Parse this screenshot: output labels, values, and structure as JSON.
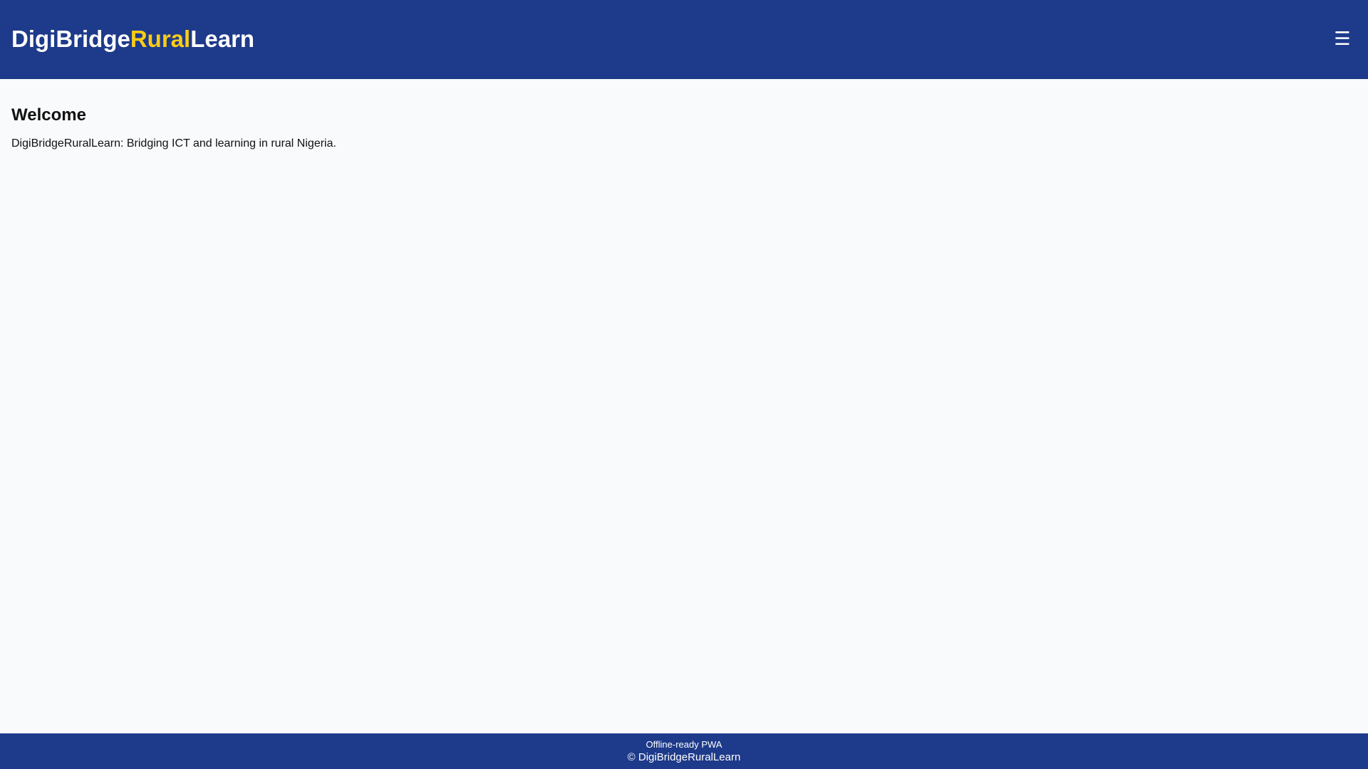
{
  "header": {
    "logo": {
      "part1": "DigiBridge",
      "part2": "Rural",
      "part3": "Learn"
    },
    "menu_icon": "☰",
    "menu_icon_name": "hamburger-menu-icon",
    "background_color": "#1e3a8a",
    "accent_color": "#facc15"
  },
  "main": {
    "title": "Welcome",
    "description": "DigiBridgeRuralLearn: Bridging ICT and learning in rural Nigeria."
  },
  "footer": {
    "status": "Offline-ready PWA",
    "copyright": "© DigiBridgeRuralLearn"
  }
}
